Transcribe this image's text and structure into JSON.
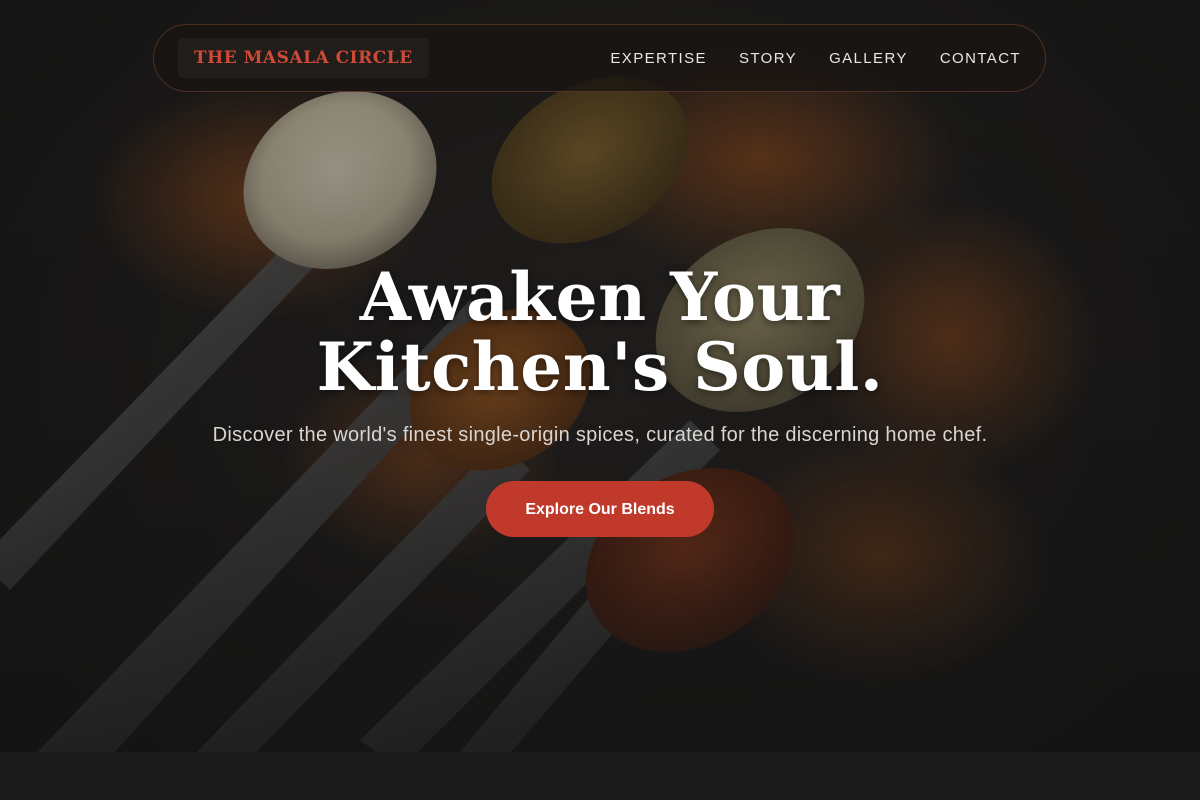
{
  "brand": {
    "name": "THE MASALA CIRCLE"
  },
  "nav": {
    "items": [
      {
        "label": "EXPERTISE"
      },
      {
        "label": "STORY"
      },
      {
        "label": "GALLERY"
      },
      {
        "label": "CONTACT"
      }
    ]
  },
  "hero": {
    "title": "Awaken Your Kitchen's Soul.",
    "subtitle": "Discover the world's finest single-origin spices, curated for the discerning home chef.",
    "cta_label": "Explore Our Blends"
  },
  "colors": {
    "accent": "#c0392b",
    "brand_text": "#cf4a36",
    "background": "#141414",
    "nav_text": "#eae6e2"
  }
}
